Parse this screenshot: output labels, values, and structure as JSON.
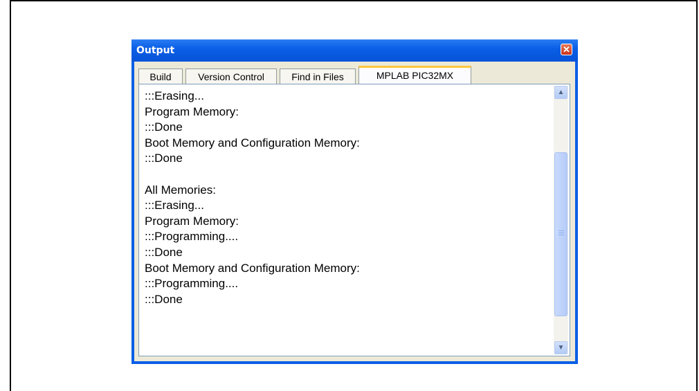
{
  "window": {
    "title": "Output",
    "close_glyph": "✕"
  },
  "tabs": [
    {
      "label": "Build",
      "active": false
    },
    {
      "label": "Version Control",
      "active": false
    },
    {
      "label": "Find in Files",
      "active": false
    },
    {
      "label": "MPLAB PIC32MX",
      "active": true
    }
  ],
  "output_lines": [
    ":::Erasing...",
    "Program Memory:",
    ":::Done",
    "Boot Memory and Configuration Memory:",
    ":::Done",
    "",
    "All Memories:",
    ":::Erasing...",
    "Program Memory:",
    ":::Programming....",
    ":::Done",
    "Boot Memory and Configuration Memory:",
    ":::Programming....",
    ":::Done"
  ],
  "scrollbar": {
    "up_icon": "chevron-up-icon",
    "down_icon": "chevron-down-icon",
    "up_glyph": "▲",
    "down_glyph": "▼"
  },
  "colors": {
    "titlebar": "#0a5fe6",
    "active_tab_accent": "#ffc83c",
    "close_button": "#c8331b"
  }
}
